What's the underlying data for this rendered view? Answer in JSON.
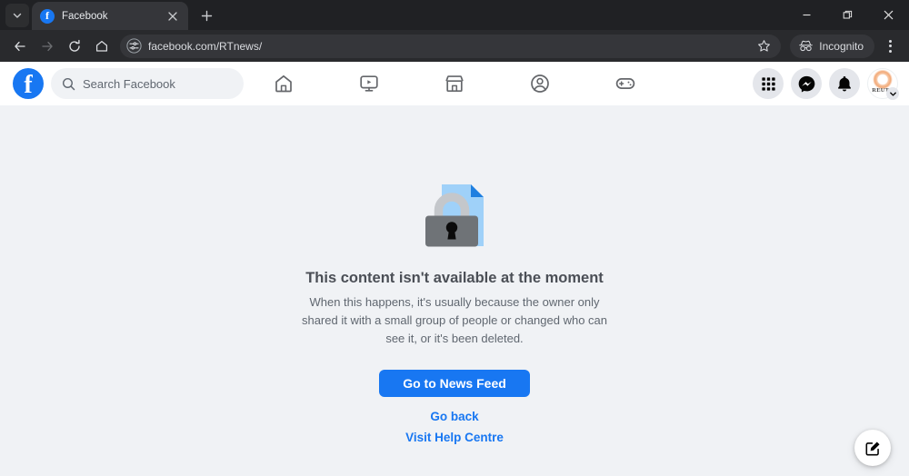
{
  "browser": {
    "tab": {
      "title": "Facebook",
      "favicon": "facebook-favicon",
      "close_label": "Close tab"
    },
    "new_tab_label": "New tab",
    "tab_search_label": "Search tabs",
    "window_controls": {
      "minimize": "Minimize",
      "maximize": "Restore",
      "close": "Close"
    },
    "nav": {
      "back": "Back",
      "forward": "Forward",
      "reload": "Reload",
      "home": "Home"
    },
    "omnibox": {
      "url": "facebook.com/RTnews/",
      "site_info_label": "View site information",
      "bookmark_label": "Bookmark this tab"
    },
    "incognito_label": "Incognito",
    "menu_label": "Customise and control Google Chrome",
    "colors": {
      "tabstrip": "#202124",
      "toolbar": "#292a2d",
      "active_tab": "#35363a",
      "text": "#dadce0"
    }
  },
  "facebook": {
    "logo_letter": "f",
    "search": {
      "placeholder": "Search Facebook",
      "value": ""
    },
    "nav_tabs": [
      {
        "name": "home",
        "label": "Home"
      },
      {
        "name": "video",
        "label": "Video"
      },
      {
        "name": "marketplace",
        "label": "Marketplace"
      },
      {
        "name": "groups",
        "label": "Groups"
      },
      {
        "name": "gaming",
        "label": "Gaming"
      }
    ],
    "actions": [
      {
        "name": "menu",
        "label": "Menu"
      },
      {
        "name": "messenger",
        "label": "Messenger"
      },
      {
        "name": "notifications",
        "label": "Notifications"
      }
    ],
    "account": {
      "label": "Account",
      "avatar_text": "REUTE",
      "chevron": "chevron-down"
    },
    "colors": {
      "brand": "#1877f2",
      "page_bg": "#f0f2f5",
      "nav_bg": "#ffffff",
      "heading": "#4b4f56",
      "body": "#606770"
    }
  },
  "error": {
    "illustration": "locked-document",
    "title": "This content isn't available at the moment",
    "body": "When this happens, it's usually because the owner only shared it with a small group of people or changed who can see it, or it's been deleted.",
    "primary_button": "Go to News Feed",
    "links": [
      "Go back",
      "Visit Help Centre"
    ]
  },
  "fab": {
    "name": "compose-post",
    "label": "Create post"
  }
}
